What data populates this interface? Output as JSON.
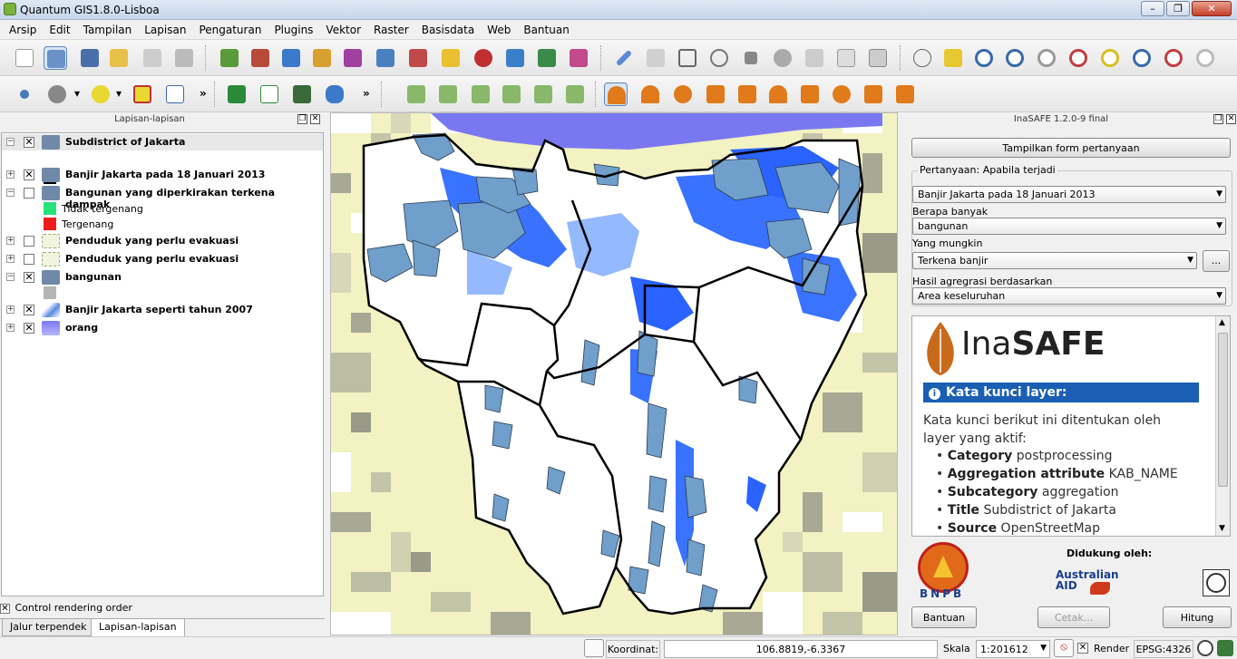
{
  "window": {
    "title": "Quantum GIS1.8.0-Lisboa"
  },
  "menu": [
    "Arsip",
    "Edit",
    "Tampilan",
    "Lapisan",
    "Pengaturan",
    "Plugins",
    "Vektor",
    "Raster",
    "Basisdata",
    "Web",
    "Bantuan"
  ],
  "colors": {
    "accent": "#1a5fb4",
    "flood_deep": "#1f5bff",
    "flood_light": "#8fb6ff",
    "polygon": "#6f9fca",
    "sea": "#7a78f0",
    "raster_light": "#f5f5b8",
    "raster_dark": "#a9a99a"
  },
  "layers_panel": {
    "title": "Lapisan-lapisan",
    "layers": [
      {
        "name": "Subdistrict of Jakarta",
        "checked": true,
        "icon": "polygon-layer-icon"
      },
      {
        "name": "Banjir Jakarta pada 18 Januari 2013",
        "checked": true,
        "icon": "polygon-layer-icon"
      },
      {
        "name": "Bangunan yang diperkirakan terkena dampak",
        "checked": false,
        "icon": "polygon-layer-icon"
      },
      {
        "name": "Penduduk yang perlu evakuasi",
        "checked": false,
        "icon": "raster-layer-icon"
      },
      {
        "name": "Penduduk yang perlu evakuasi",
        "checked": false,
        "icon": "raster-layer-icon"
      },
      {
        "name": "bangunan",
        "checked": true,
        "icon": "polygon-layer-icon"
      },
      {
        "name": "Banjir Jakarta seperti tahun 2007",
        "checked": true,
        "icon": "raster-layer-icon"
      },
      {
        "name": "orang",
        "checked": true,
        "icon": "raster-layer-icon"
      }
    ],
    "legend": {
      "not_affected": "Tidak tergenang",
      "affected": "Tergenang"
    },
    "control_rendering": "Control rendering order",
    "tabs": [
      "Jalur terpendek",
      "Lapisan-lapisan"
    ]
  },
  "inasafe": {
    "title": "InaSAFE 1.2.0-9 final",
    "show_form_button": "Tampilkan form pertanyaan",
    "question_label": "Pertanyaan: Apabila terjadi",
    "hazard": "Banjir Jakarta pada 18 Januari 2013",
    "how_many_label": "Berapa banyak",
    "exposure": "bangunan",
    "might_label": "Yang mungkin",
    "function": "Terkena banjir",
    "more_button": "...",
    "aggregation_label": "Hasil agregrasi berdasarkan",
    "aggregation": "Area keseluruhan",
    "logo_text_a": "Ina",
    "logo_text_b": "SAFE",
    "keywords_header": "Kata kunci layer:",
    "keywords_intro": "Kata kunci berikut ini ditentukan oleh layer yang aktif:",
    "keywords": [
      {
        "key": "Category",
        "value": "postprocessing"
      },
      {
        "key": "Aggregation attribute",
        "value": "KAB_NAME"
      },
      {
        "key": "Subcategory",
        "value": "aggregation"
      },
      {
        "key": "Title",
        "value": "Subdistrict of Jakarta"
      },
      {
        "key": "Source",
        "value": "OpenStreetMap"
      }
    ],
    "supported_by": "Didukung oleh:",
    "bnpb": "BNPB",
    "aid_line1": "Australian",
    "aid_line2": "AID",
    "help_button": "Bantuan",
    "print_button": "Cetak...",
    "run_button": "Hitung"
  },
  "status": {
    "coord_label": "Koordinat:",
    "coord_value": "106.8819,-6.3367",
    "scale_label": "Skala",
    "scale_value": "1:201612",
    "render_label": "Render",
    "epsg": "EPSG:4326"
  }
}
